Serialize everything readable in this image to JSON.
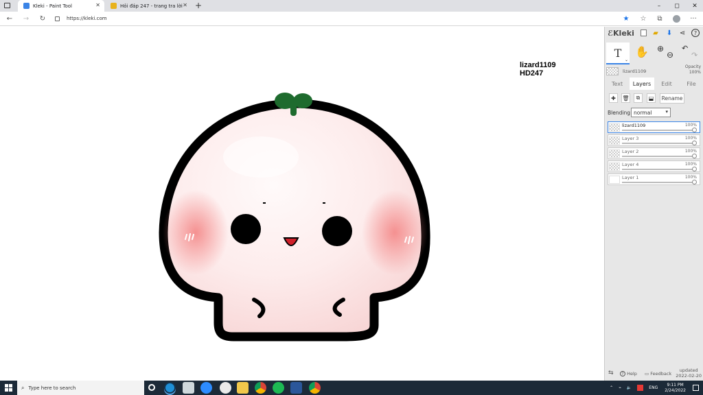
{
  "browser": {
    "tabs": [
      {
        "title": "Kleki - Paint Tool",
        "active": true
      },
      {
        "title": "Hỏi đáp 247 - trang tra lời",
        "active": false
      }
    ],
    "new_tab": "+",
    "url": "https://kleki.com",
    "window_controls": {
      "minimize": "–",
      "maximize": "◻",
      "close": "✕"
    }
  },
  "canvas": {
    "signature_line1": "lizard1109",
    "signature_line2": "HD247"
  },
  "sidebar": {
    "brand": "Kleki",
    "tool_text_glyph": "T",
    "opacity_label": "Opacity",
    "opacity_value": "100%",
    "current_layer_name": "lizard1109",
    "tabs": [
      {
        "label": "Text",
        "active": false
      },
      {
        "label": "Layers",
        "active": true
      },
      {
        "label": "Edit",
        "active": false
      },
      {
        "label": "File",
        "active": false
      }
    ],
    "rename_label": "Rename",
    "blending_label": "Blending",
    "blending_value": "normal",
    "layers": [
      {
        "name": "lizard1109",
        "opacity": "100%",
        "selected": true
      },
      {
        "name": "Layer 3",
        "opacity": "100%",
        "selected": false
      },
      {
        "name": "Layer 2",
        "opacity": "100%",
        "selected": false
      },
      {
        "name": "Layer 4",
        "opacity": "100%",
        "selected": false
      },
      {
        "name": "Layer 1",
        "opacity": "100%",
        "selected": false
      }
    ],
    "footer": {
      "help": "Help",
      "feedback": "Feedback",
      "updated_line1": "updated",
      "updated_line2": "2022-02-20"
    }
  },
  "taskbar": {
    "search_placeholder": "Type here to search",
    "language": "ENG",
    "time": "9:11 PM",
    "date": "2/24/2022"
  },
  "colors": {
    "accent": "#3a84e6",
    "mushroom_outline": "#000000",
    "mushroom_body": "#fde6e6",
    "blush": "#f49b9b",
    "leaf": "#1e6b2e",
    "taskbar": "#1c2a38"
  }
}
